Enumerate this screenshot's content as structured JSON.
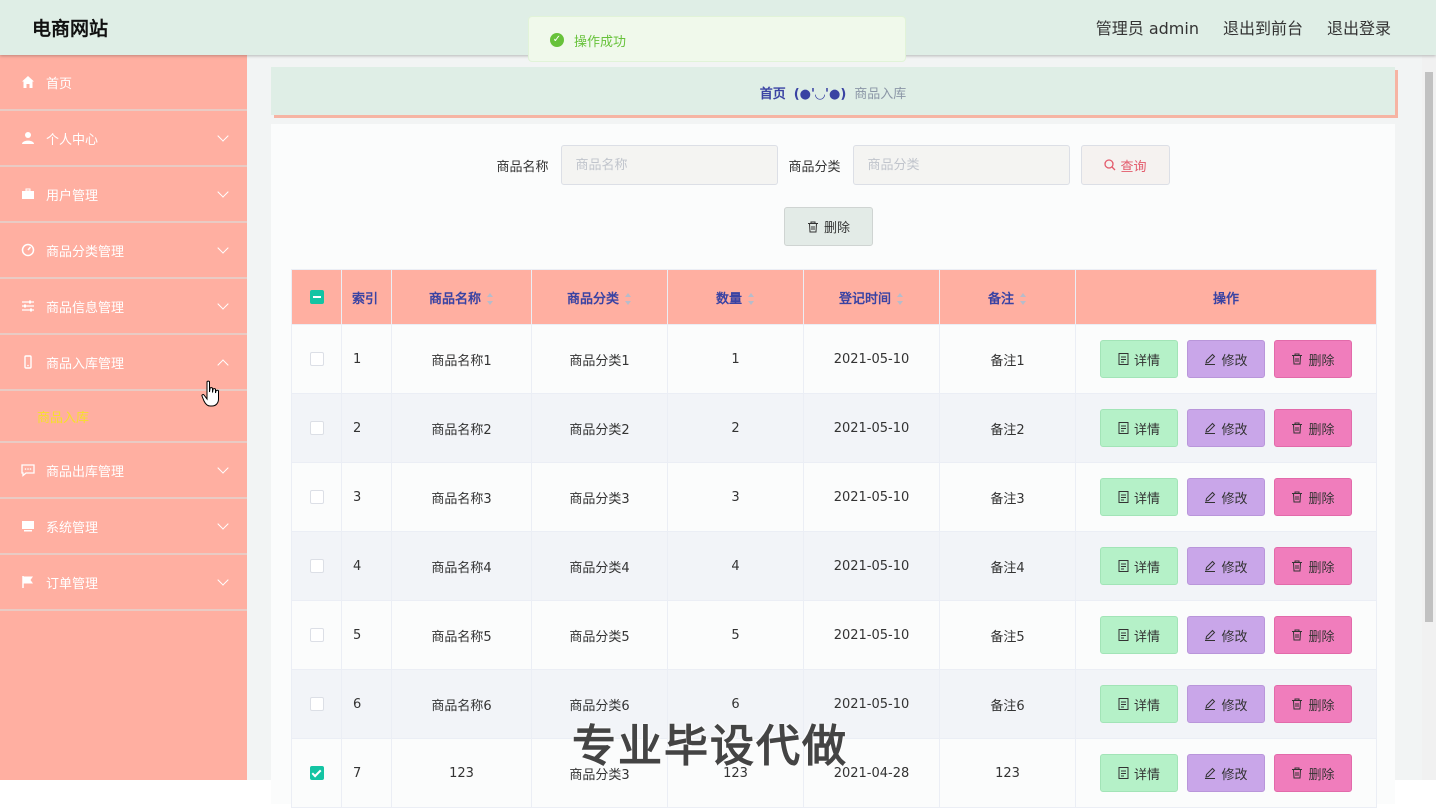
{
  "header": {
    "brand": "电商网站",
    "admin_label": "管理员 admin",
    "to_front": "退出到前台",
    "logout": "退出登录"
  },
  "toast": {
    "message": "操作成功"
  },
  "sidebar": {
    "items": [
      {
        "label": "首页",
        "icon": "home-icon"
      },
      {
        "label": "个人中心",
        "icon": "user-icon"
      },
      {
        "label": "用户管理",
        "icon": "briefcase-icon"
      },
      {
        "label": "商品分类管理",
        "icon": "gauge-icon"
      },
      {
        "label": "商品信息管理",
        "icon": "sliders-icon"
      },
      {
        "label": "商品入库管理",
        "icon": "phone-icon"
      },
      {
        "label": "商品出库管理",
        "icon": "chat-icon"
      },
      {
        "label": "系统管理",
        "icon": "monitor-icon"
      },
      {
        "label": "订单管理",
        "icon": "flag-icon"
      }
    ],
    "active_sub": "商品入库"
  },
  "breadcrumb": {
    "home": "首页",
    "sep": "(●'◡'●)",
    "current": "商品入库"
  },
  "search": {
    "name_label": "商品名称",
    "name_placeholder": "商品名称",
    "category_label": "商品分类",
    "category_placeholder": "商品分类",
    "query_button": "查询",
    "delete_button": "删除"
  },
  "table": {
    "columns": [
      "索引",
      "商品名称",
      "商品分类",
      "数量",
      "登记时间",
      "备注",
      "操作"
    ],
    "actions": {
      "detail": "详情",
      "edit": "修改",
      "delete": "删除"
    },
    "rows": [
      {
        "index": "1",
        "name": "商品名称1",
        "category": "商品分类1",
        "qty": "1",
        "date": "2021-05-10",
        "note": "备注1",
        "checked": false
      },
      {
        "index": "2",
        "name": "商品名称2",
        "category": "商品分类2",
        "qty": "2",
        "date": "2021-05-10",
        "note": "备注2",
        "checked": false
      },
      {
        "index": "3",
        "name": "商品名称3",
        "category": "商品分类3",
        "qty": "3",
        "date": "2021-05-10",
        "note": "备注3",
        "checked": false
      },
      {
        "index": "4",
        "name": "商品名称4",
        "category": "商品分类4",
        "qty": "4",
        "date": "2021-05-10",
        "note": "备注4",
        "checked": false
      },
      {
        "index": "5",
        "name": "商品名称5",
        "category": "商品分类5",
        "qty": "5",
        "date": "2021-05-10",
        "note": "备注5",
        "checked": false
      },
      {
        "index": "6",
        "name": "商品名称6",
        "category": "商品分类6",
        "qty": "6",
        "date": "2021-05-10",
        "note": "备注6",
        "checked": false
      },
      {
        "index": "7",
        "name": "123",
        "category": "商品分类3",
        "qty": "123",
        "date": "2021-04-28",
        "note": "123",
        "checked": true
      }
    ]
  },
  "watermark": "专业毕设代做",
  "colors": {
    "sidebar": "#ffafa1",
    "header": "#dfeee6",
    "accent": "#3a43a3",
    "check": "#13c4a3"
  }
}
